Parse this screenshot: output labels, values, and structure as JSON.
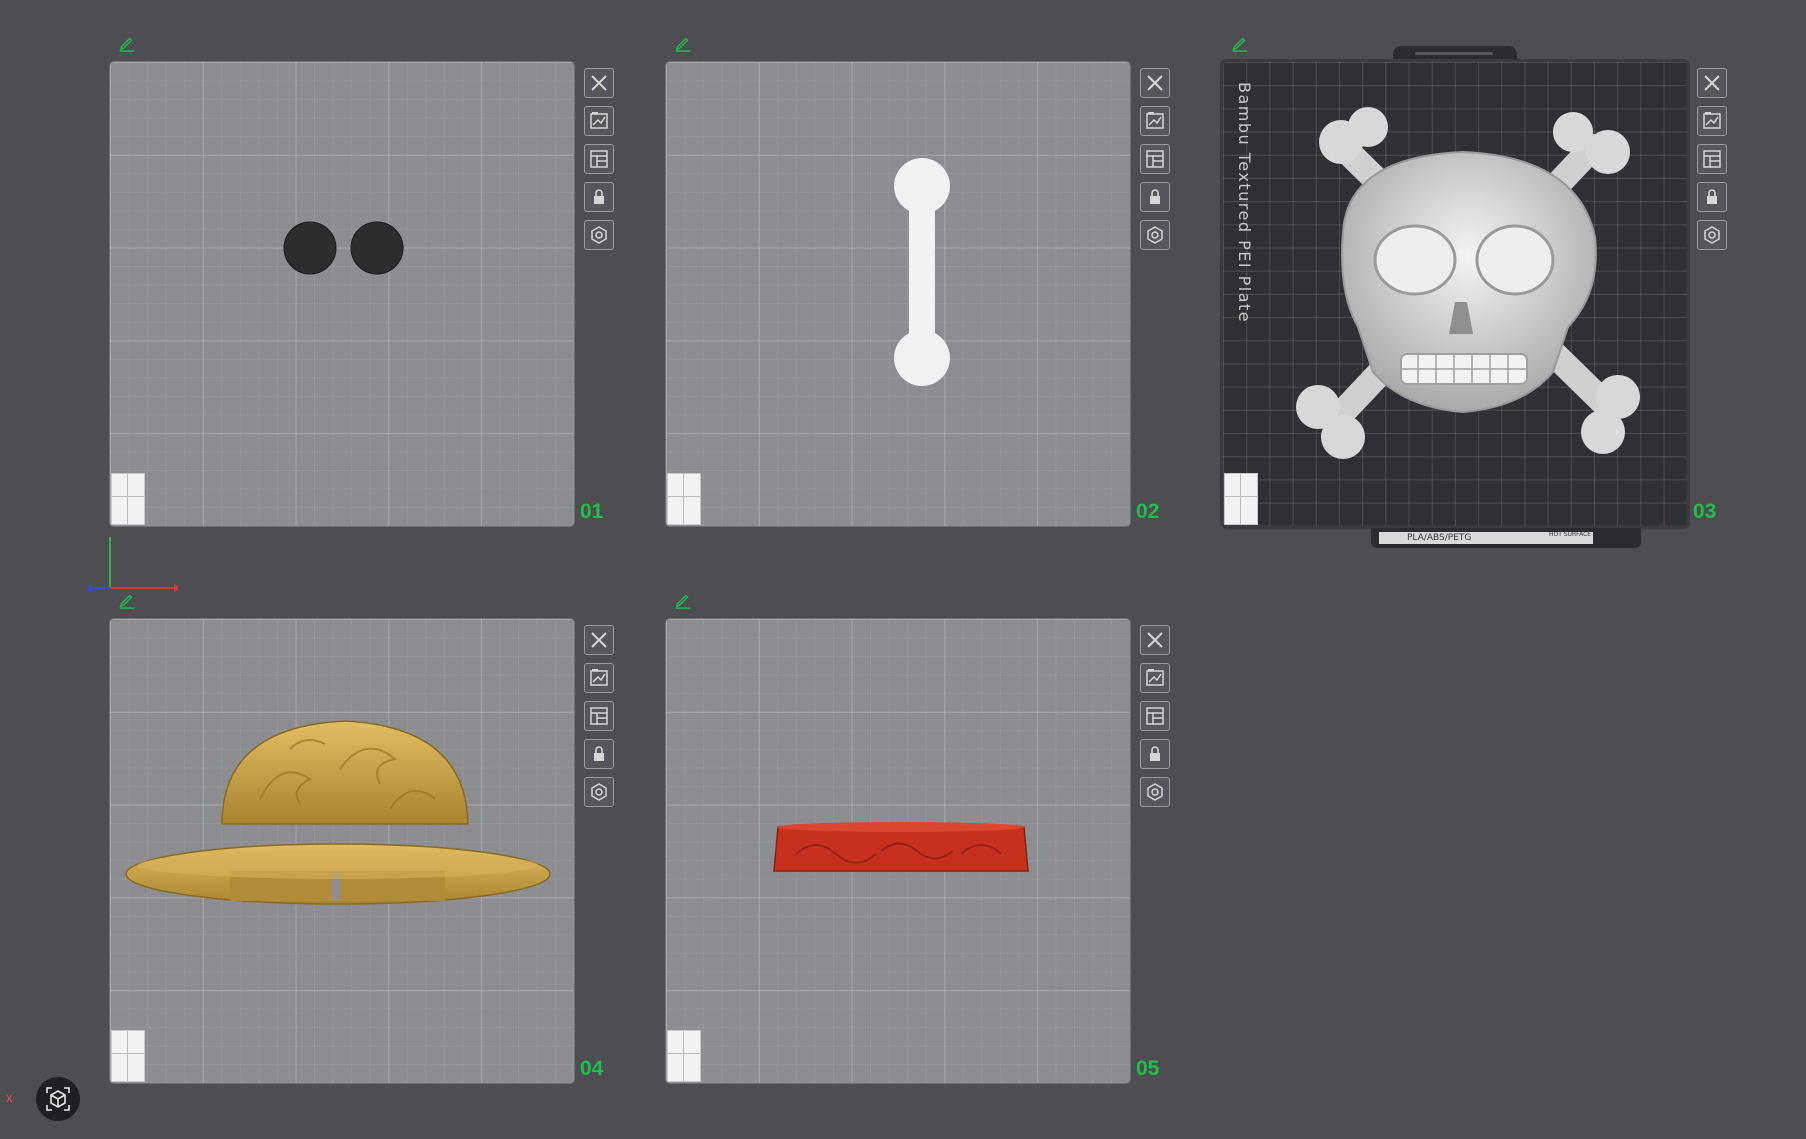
{
  "plates": [
    {
      "number": "01",
      "model": "two-dark-discs"
    },
    {
      "number": "02",
      "model": "white-bone-bar"
    },
    {
      "number": "03",
      "model": "skull-crossbones",
      "plate_label": "Bambu Textured PEI Plate",
      "material_text": "PLA/ABS/PETG",
      "surface_text": "HOT SURFACE"
    },
    {
      "number": "04",
      "model": "gold-hat"
    },
    {
      "number": "05",
      "model": "red-hat-band"
    }
  ],
  "plate_tools": [
    "close-icon",
    "arrange-icon",
    "layout-icon",
    "lock-icon",
    "settings-icon"
  ],
  "corner_close": "x",
  "colors": {
    "background": "#4d4d52",
    "plate_number": "#1fbf4a",
    "edit_icon": "#1fbf4a",
    "gold": "#c9a24a",
    "red": "#c8301e"
  }
}
